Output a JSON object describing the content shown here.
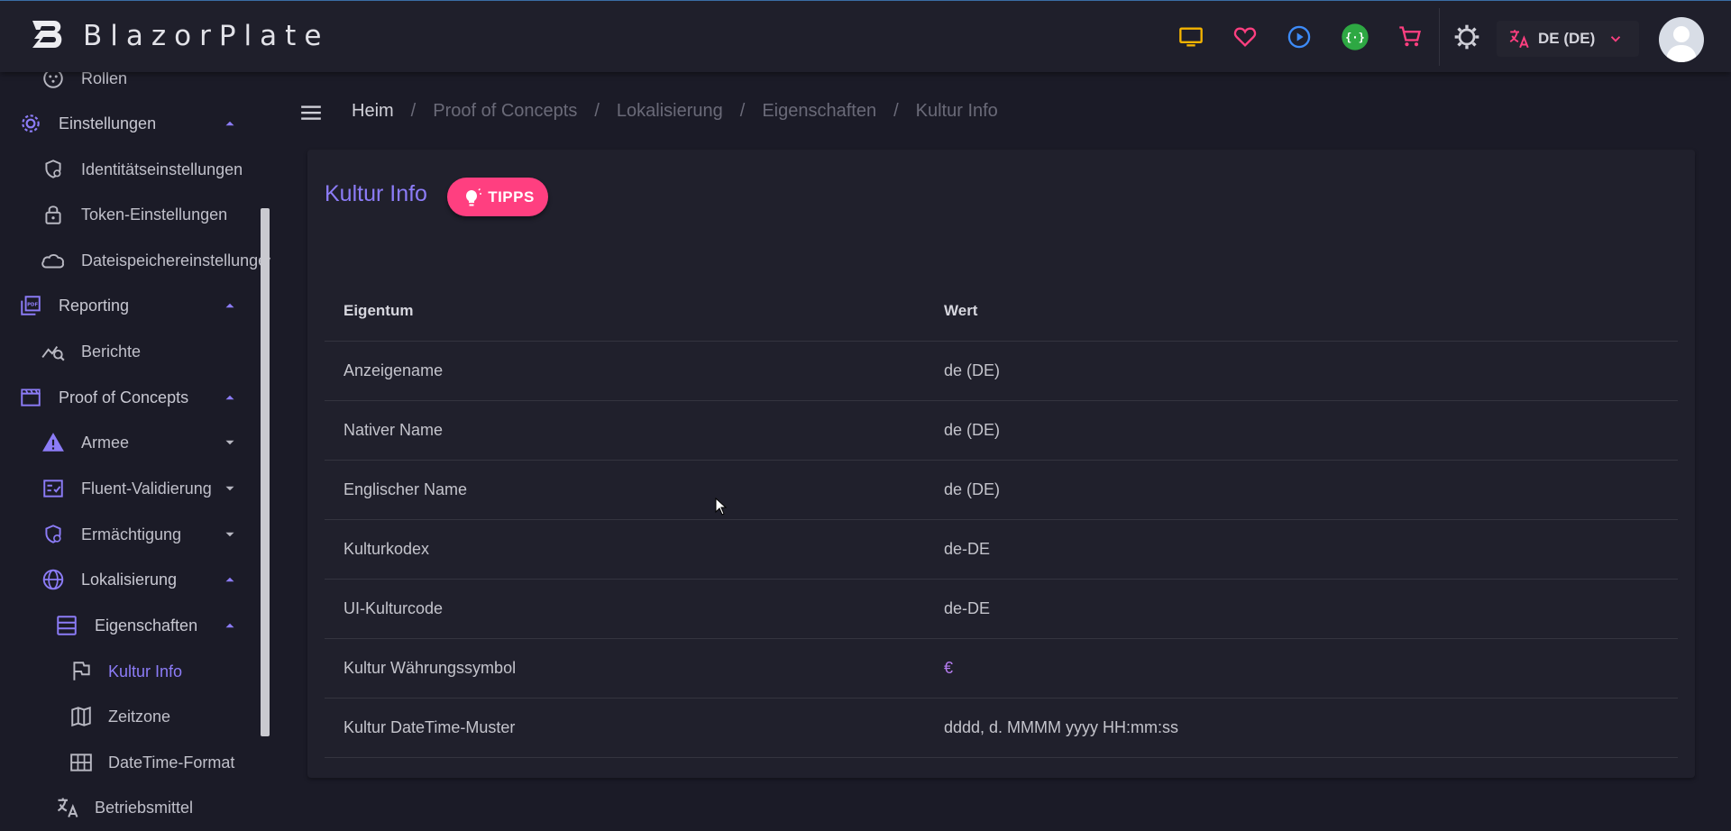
{
  "app": {
    "brand_name": "BlazorPlate"
  },
  "header": {
    "language_label": "DE (DE)",
    "icons": [
      "tv-icon",
      "heart-icon",
      "play-circle-icon",
      "api-icon",
      "cart-icon",
      "gear-icon",
      "translate-icon",
      "chevron-down-icon",
      "avatar-icon"
    ],
    "colors": {
      "tv": "#f5b400",
      "heart": "#ff3f80",
      "play": "#3d8bf8",
      "api": "#2ea843",
      "cart": "#ff3f80",
      "translate": "#ff3f80"
    }
  },
  "sidebar": {
    "items": [
      {
        "label": "Rollen",
        "icon": "roles-icon"
      },
      {
        "label": "Einstellungen",
        "icon": "gear-icon"
      },
      {
        "label": "Identitätseinstellungen",
        "icon": "shield-gear-icon"
      },
      {
        "label": "Token-Einstellungen",
        "icon": "lock-icon"
      },
      {
        "label": "Dateispeichereinstellungen",
        "icon": "cloud-icon"
      },
      {
        "label": "Reporting",
        "icon": "pdf-icon"
      },
      {
        "label": "Berichte",
        "icon": "chart-search-icon"
      },
      {
        "label": "Proof of Concepts",
        "icon": "clapperboard-icon"
      },
      {
        "label": "Armee",
        "icon": "warning-icon"
      },
      {
        "label": "Fluent-Validierung",
        "icon": "checklist-icon"
      },
      {
        "label": "Ermächtigung",
        "icon": "shield-lock-icon"
      },
      {
        "label": "Lokalisierung",
        "icon": "globe-icon"
      },
      {
        "label": "Eigenschaften",
        "icon": "list-icon"
      },
      {
        "label": "Kultur Info",
        "icon": "flag-icon"
      },
      {
        "label": "Zeitzone",
        "icon": "map-icon"
      },
      {
        "label": "DateTime-Format",
        "icon": "grid-icon"
      },
      {
        "label": "Betriebsmittel",
        "icon": "translate-icon"
      }
    ],
    "accent_color": "#8c7cf7"
  },
  "breadcrumb": [
    "Heim",
    "Proof of Concepts",
    "Lokalisierung",
    "Eigenschaften",
    "Kultur Info"
  ],
  "main": {
    "title": "Kultur Info",
    "tips_label": "TIPPS",
    "table": {
      "headers": [
        "Eigentum",
        "Wert"
      ],
      "rows": [
        {
          "property": "Anzeigename",
          "value": "de (DE)"
        },
        {
          "property": "Nativer Name",
          "value": "de (DE)"
        },
        {
          "property": "Englischer Name",
          "value": "de (DE)"
        },
        {
          "property": "Kulturkodex",
          "value": "de-DE"
        },
        {
          "property": "UI-Kulturcode",
          "value": "de-DE"
        },
        {
          "property": "Kultur Währungssymbol",
          "value": "€"
        },
        {
          "property": "Kultur DateTime-Muster",
          "value": "dddd, d. MMMM yyyy HH:mm:ss"
        }
      ]
    }
  }
}
